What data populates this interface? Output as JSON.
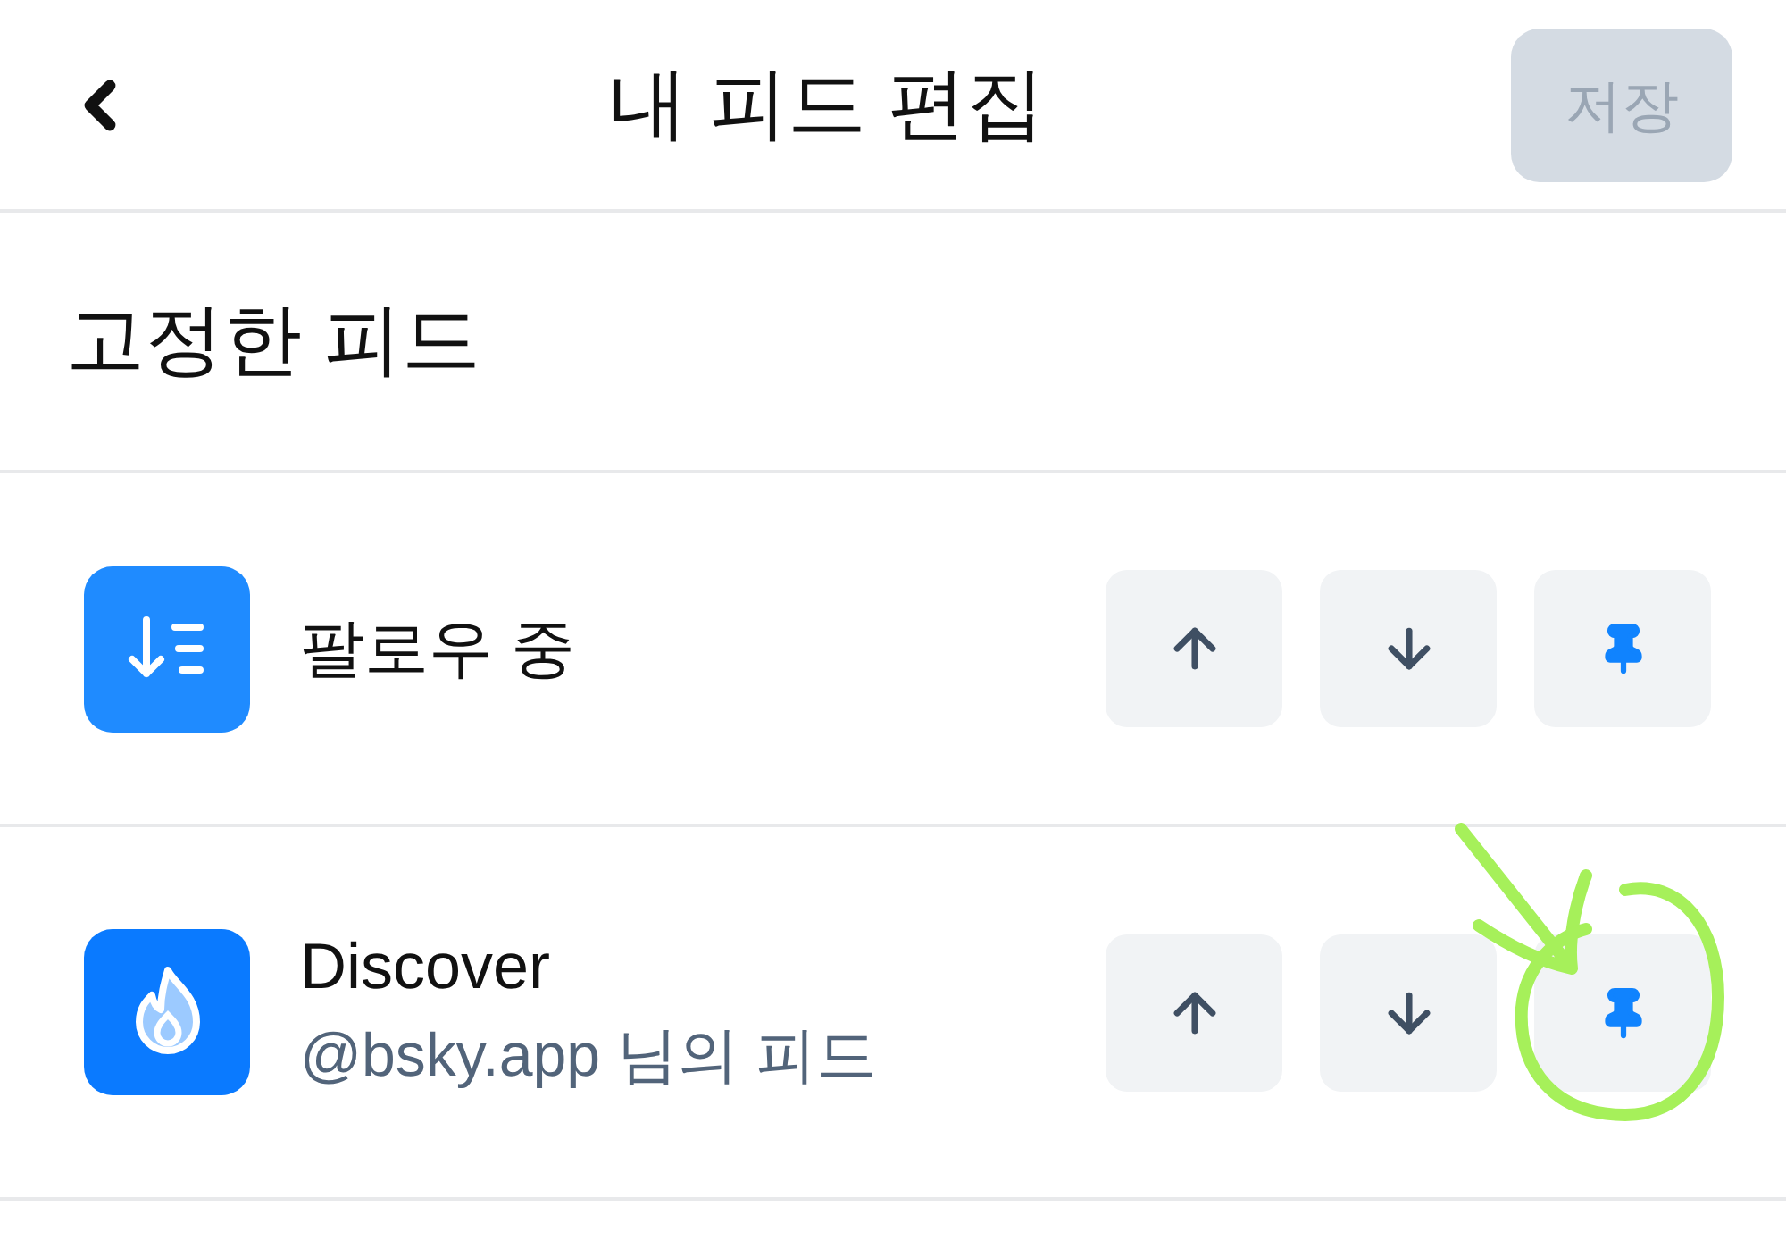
{
  "header": {
    "title": "내 피드 편집",
    "save_button": {
      "label": "저장",
      "disabled": true
    }
  },
  "section": {
    "title": "고정한 피드"
  },
  "feeds": [
    {
      "kind": "following",
      "title": "팔로우 중",
      "pinned": true
    },
    {
      "kind": "discover",
      "title": "Discover",
      "subtitle": "@bsky.app 님의 피드",
      "pinned": true
    }
  ]
}
